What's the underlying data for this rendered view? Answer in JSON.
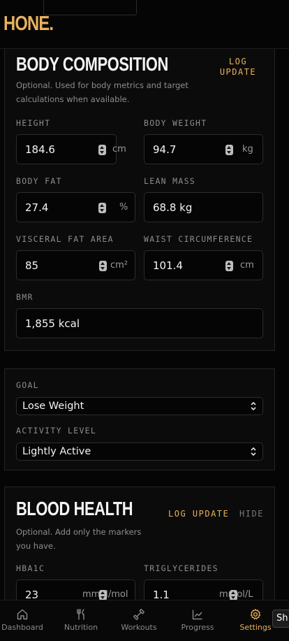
{
  "app": {
    "logo": "HONE."
  },
  "body_composition": {
    "title": "BODY COMPOSITION",
    "log_update": "LOG\nUPDATE",
    "description": "Optional. Used for body metrics and target calculations when available.",
    "fields": {
      "height": {
        "label": "HEIGHT",
        "value": "184.6",
        "unit": "cm"
      },
      "body_weight": {
        "label": "BODY WEIGHT",
        "value": "94.7",
        "unit": "kg"
      },
      "body_fat": {
        "label": "BODY FAT",
        "value": "27.4",
        "unit": "%"
      },
      "lean_mass": {
        "label": "LEAN MASS",
        "value": "68.8 kg"
      },
      "visceral_fat": {
        "label": "VISCERAL FAT AREA",
        "value": "85",
        "unit": "cm²"
      },
      "waist": {
        "label": "WAIST CIRCUMFERENCE",
        "value": "101.4",
        "unit": "cm"
      },
      "bmr": {
        "label": "BMR",
        "value": "1,855 kcal"
      }
    }
  },
  "goals": {
    "goal": {
      "label": "GOAL",
      "value": "Lose Weight"
    },
    "activity": {
      "label": "ACTIVITY LEVEL",
      "value": "Lightly Active"
    }
  },
  "blood_health": {
    "title": "BLOOD HEALTH",
    "log_update": "LOG UPDATE",
    "hide": "HIDE",
    "description": "Optional. Add only the markers you have.",
    "fields": {
      "hba1c": {
        "label": "HBA1C",
        "value": "23",
        "unit": "mmol/mol"
      },
      "triglycerides": {
        "label": "TRIGLYCERIDES",
        "value": "1.1",
        "unit": "mmol/L"
      }
    }
  },
  "nav": {
    "items": [
      {
        "label": "Dashboard",
        "icon": "home-icon"
      },
      {
        "label": "Nutrition",
        "icon": "utensils-icon"
      },
      {
        "label": "Workouts",
        "icon": "dumbbell-icon"
      },
      {
        "label": "Progress",
        "icon": "chart-line-icon"
      },
      {
        "label": "Settings",
        "icon": "gear-icon"
      }
    ],
    "active": "Settings"
  },
  "tooltip": {
    "text": "Sh"
  },
  "colors": {
    "accent": "#e8b25c",
    "background": "#050505",
    "card": "#0b0b0b",
    "border": "#242424"
  }
}
